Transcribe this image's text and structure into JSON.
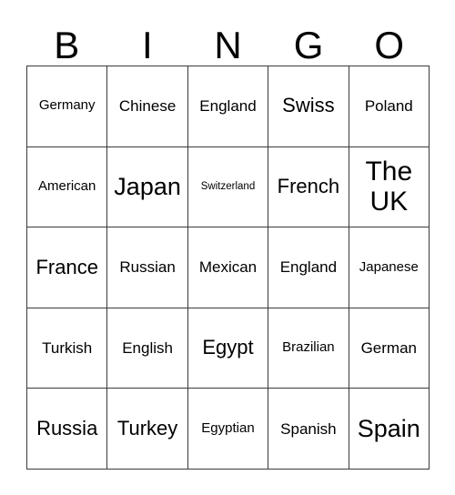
{
  "card": {
    "title": "BINGO",
    "header_letters": [
      "B",
      "I",
      "N",
      "G",
      "O"
    ],
    "border_color": "#3a3a3a",
    "background_color": "#ffffff",
    "text_color": "#000000",
    "rows": 5,
    "columns": 5,
    "cells": [
      [
        {
          "label": "Germany",
          "size": "s"
        },
        {
          "label": "Chinese",
          "size": "m"
        },
        {
          "label": "England",
          "size": "m"
        },
        {
          "label": "Swiss",
          "size": "l"
        },
        {
          "label": "Poland",
          "size": "m"
        }
      ],
      [
        {
          "label": "American",
          "size": "s"
        },
        {
          "label": "Japan",
          "size": "xl"
        },
        {
          "label": "Switzerland",
          "size": "xs"
        },
        {
          "label": "French",
          "size": "l"
        },
        {
          "label": "The UK",
          "size": "xxl"
        }
      ],
      [
        {
          "label": "France",
          "size": "l"
        },
        {
          "label": "Russian",
          "size": "m"
        },
        {
          "label": "Mexican",
          "size": "m"
        },
        {
          "label": "England",
          "size": "m"
        },
        {
          "label": "Japanese",
          "size": "s"
        }
      ],
      [
        {
          "label": "Turkish",
          "size": "m"
        },
        {
          "label": "English",
          "size": "m"
        },
        {
          "label": "Egypt",
          "size": "l"
        },
        {
          "label": "Brazilian",
          "size": "s"
        },
        {
          "label": "German",
          "size": "m"
        }
      ],
      [
        {
          "label": "Russia",
          "size": "l"
        },
        {
          "label": "Turkey",
          "size": "l"
        },
        {
          "label": "Egyptian",
          "size": "s"
        },
        {
          "label": "Spanish",
          "size": "m"
        },
        {
          "label": "Spain",
          "size": "xl"
        }
      ]
    ]
  }
}
